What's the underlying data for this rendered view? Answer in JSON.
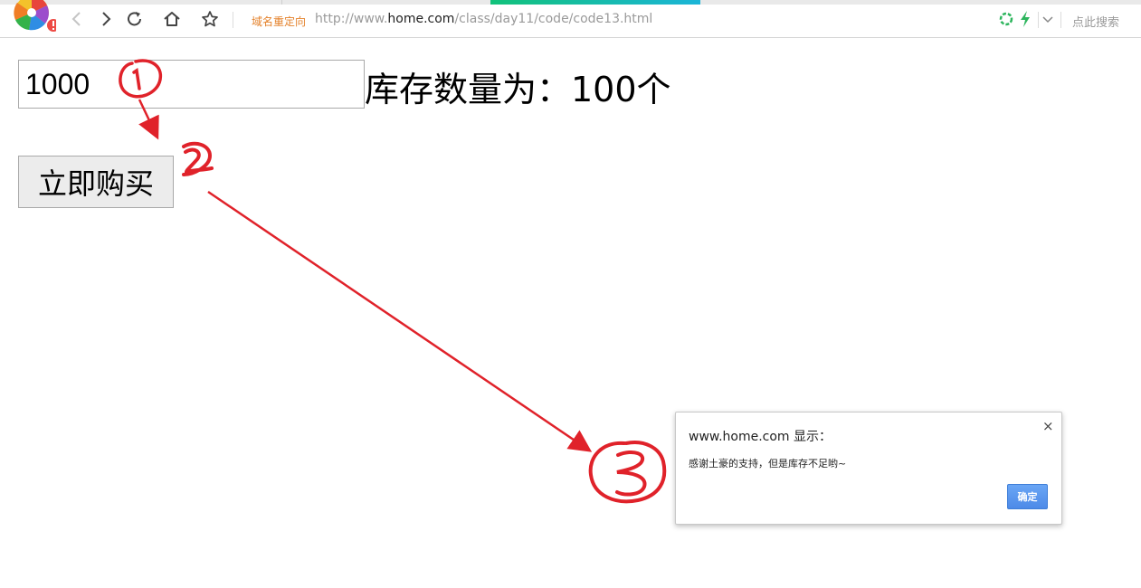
{
  "browser": {
    "redirect_label": "域名重定向",
    "url_scheme": "http://www.",
    "url_host": "home.com",
    "url_path": "/class/day11/code/code13.html",
    "search_label": "点此搜索"
  },
  "page": {
    "amount_value": "1000",
    "stock_text": "库存数量为：100个",
    "buy_button_label": "立即购买"
  },
  "dialog": {
    "title": "www.home.com 显示：",
    "message": "感谢土豪的支持，但是库存不足哟~",
    "ok_label": "确定",
    "close_symbol": "×"
  },
  "annotations": {
    "color": "#e0222a"
  },
  "colors": {
    "redirect": "#e4812a",
    "accent_progress": "#12c27a",
    "dialog_button": "#4d8ae8"
  },
  "icons": [
    "browser-logo-icon",
    "back-icon",
    "forward-icon",
    "reload-icon",
    "home-icon",
    "bookmark-star-icon",
    "security-shield-icon",
    "lightning-icon",
    "chevron-down-icon",
    "close-icon"
  ]
}
